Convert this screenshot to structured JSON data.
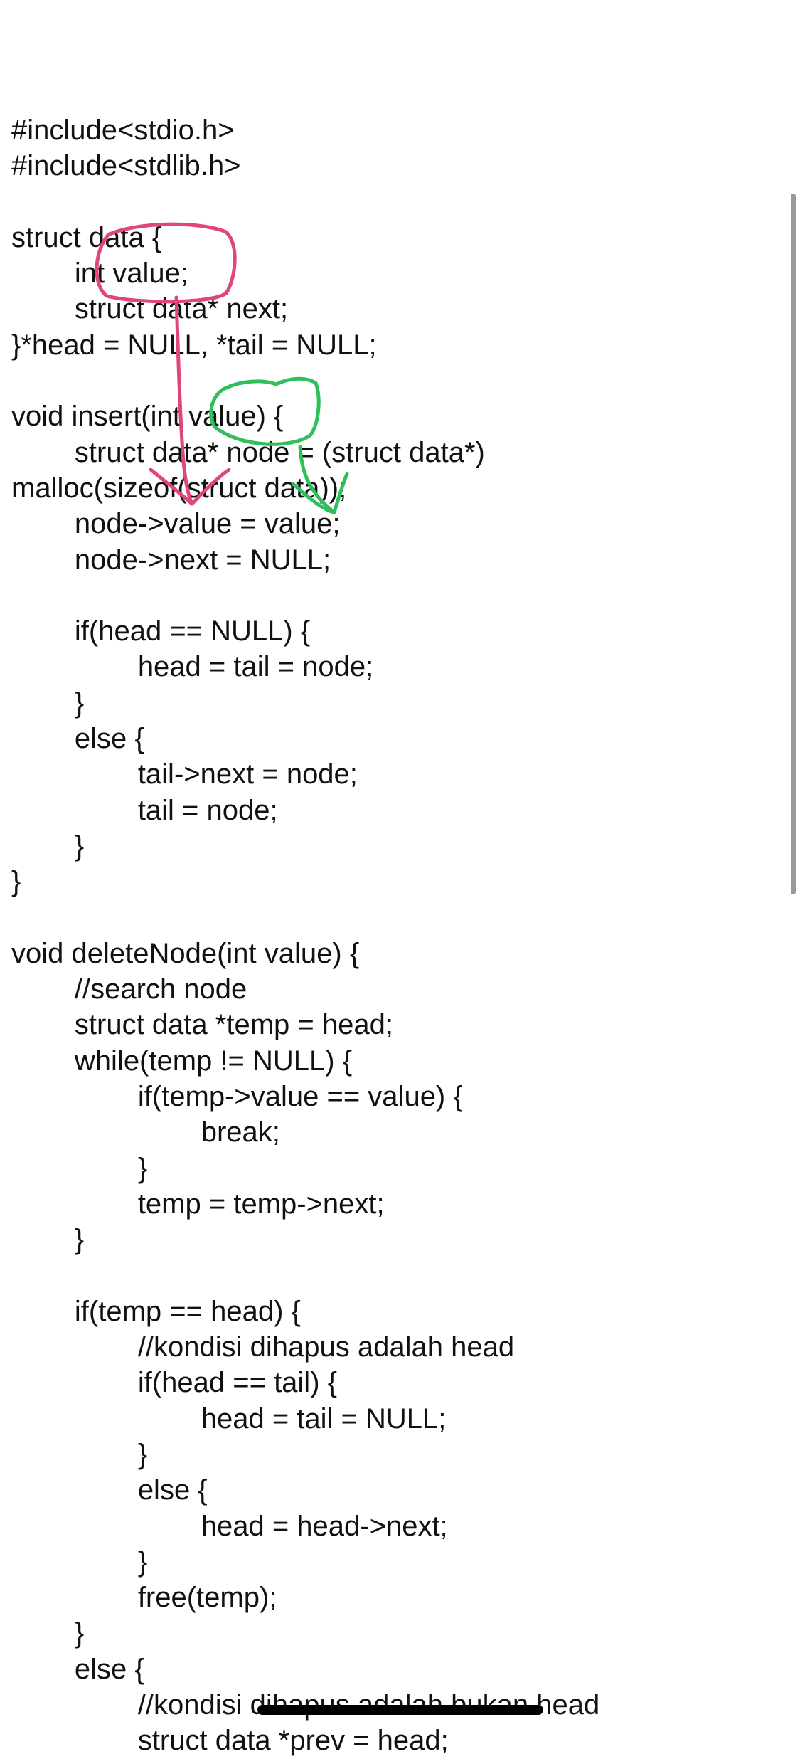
{
  "document": {
    "lines": [
      "#include<stdio.h>",
      "#include<stdlib.h>",
      "",
      "struct data {",
      "        int value;",
      "        struct data* next;",
      "}*head = NULL, *tail = NULL;",
      "",
      "void insert(int value) {",
      "        struct data* node = (struct data*)",
      "malloc(sizeof(struct data));",
      "        node->value = value;",
      "        node->next = NULL;",
      "",
      "        if(head == NULL) {",
      "                head = tail = node;",
      "        }",
      "        else {",
      "                tail->next = node;",
      "                tail = node;",
      "        }",
      "}",
      "",
      "void deleteNode(int value) {",
      "        //search node",
      "        struct data *temp = head;",
      "        while(temp != NULL) {",
      "                if(temp->value == value) {",
      "                        break;",
      "                }",
      "                temp = temp->next;",
      "        }",
      "",
      "        if(temp == head) {",
      "                //kondisi dihapus adalah head",
      "                if(head == tail) {",
      "                        head = tail = NULL;",
      "                }",
      "                else {",
      "                        head = head->next;",
      "                }",
      "                free(temp);",
      "        }",
      "        else {",
      "                //kondisi dihapus adalah bukan head",
      "                struct data *prev = head;"
    ]
  },
  "annotations": {
    "pink_color": "#e0457b",
    "green_color": "#2fbf5b"
  }
}
